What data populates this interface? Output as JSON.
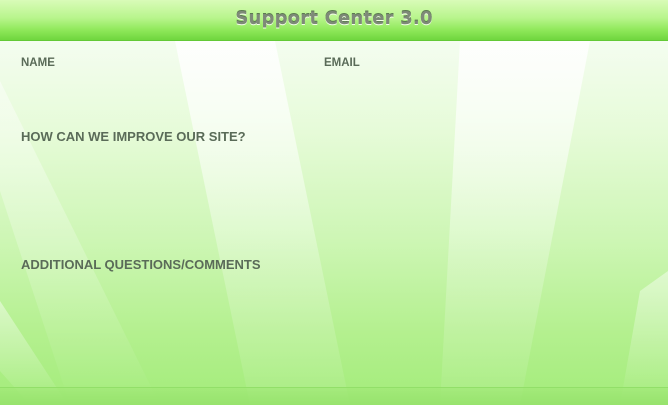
{
  "window": {
    "title": "Support Center 3.0"
  },
  "form": {
    "name_label": "NAME",
    "email_label": "EMAIL",
    "improve_label": "HOW CAN WE IMPROVE OUR SITE?",
    "comments_label": "ADDITIONAL QUESTIONS/COMMENTS",
    "name_value": "",
    "email_value": "",
    "improve_value": "",
    "comments_value": ""
  },
  "colors": {
    "titlebar_accent": "#8fe85a",
    "title_text": "#7e8a78",
    "label_text": "#5a6b58",
    "background_light": "#f4fdf0",
    "background_green": "#a3ec7a"
  }
}
